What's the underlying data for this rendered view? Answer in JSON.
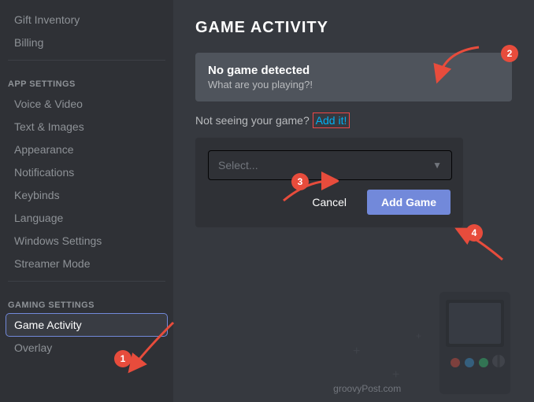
{
  "sidebar": {
    "app_settings_label": "APP SETTINGS",
    "gaming_settings_label": "GAMING SETTINGS",
    "items_top": [
      {
        "id": "gift-inventory",
        "label": "Gift Inventory"
      },
      {
        "id": "billing",
        "label": "Billing"
      }
    ],
    "items_app": [
      {
        "id": "voice-video",
        "label": "Voice & Video"
      },
      {
        "id": "text-images",
        "label": "Text & Images"
      },
      {
        "id": "appearance",
        "label": "Appearance"
      },
      {
        "id": "notifications",
        "label": "Notifications"
      },
      {
        "id": "keybinds",
        "label": "Keybinds"
      },
      {
        "id": "language",
        "label": "Language"
      },
      {
        "id": "windows-settings",
        "label": "Windows Settings"
      },
      {
        "id": "streamer-mode",
        "label": "Streamer Mode"
      }
    ],
    "items_gaming": [
      {
        "id": "game-activity",
        "label": "Game Activity",
        "active": true
      },
      {
        "id": "overlay",
        "label": "Overlay"
      }
    ]
  },
  "main": {
    "title": "GAME ACTIVITY",
    "no_game_title": "No game detected",
    "no_game_sub": "What are you playing?!",
    "not_seeing_text": "Not seeing your game?",
    "add_it_label": "Add it!",
    "select_placeholder": "Select...",
    "cancel_label": "Cancel",
    "add_game_label": "Add Game"
  },
  "watermark": {
    "text": "groovyPost.com"
  },
  "badges": {
    "b1": "1",
    "b2": "2",
    "b3": "3",
    "b4": "4"
  },
  "colors": {
    "accent": "#7289da",
    "add_it_border": "#f04747",
    "add_it_color": "#00b0f4",
    "badge_bg": "#e74c3c"
  }
}
